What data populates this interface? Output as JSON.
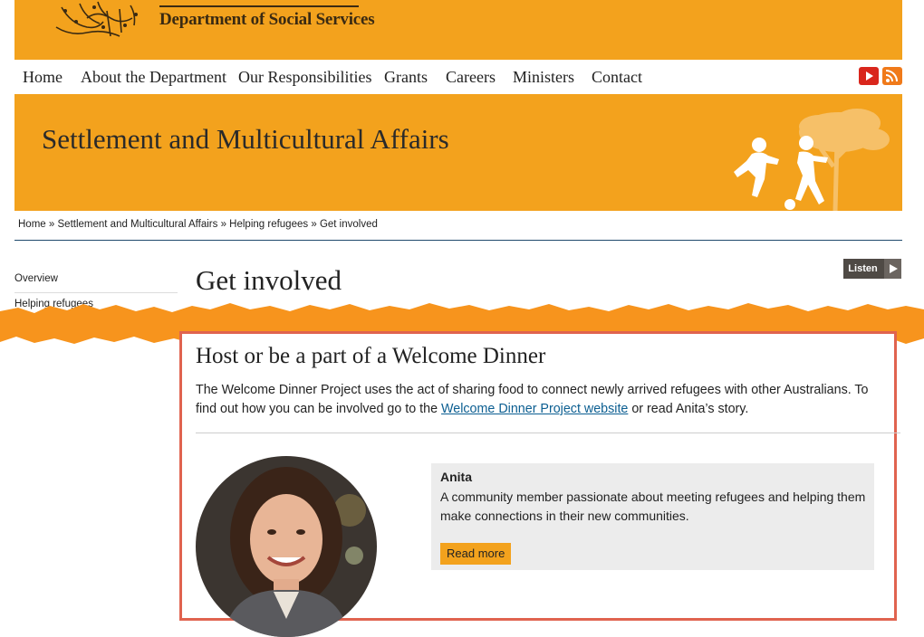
{
  "header": {
    "department": "Department of Social Services"
  },
  "nav": {
    "items": [
      "Home",
      "About the Department",
      "Our Responsibilities",
      "Grants",
      "Careers",
      "Ministers",
      "Contact"
    ],
    "social_icons": [
      "youtube-icon",
      "rss-icon"
    ]
  },
  "banner": {
    "title": "Settlement and Multicultural Affairs"
  },
  "breadcrumb": {
    "items": [
      "Home",
      "Settlement and Multicultural Affairs",
      "Helping refugees",
      "Get involved"
    ],
    "separator": "»"
  },
  "sidebar": {
    "items": [
      "Overview",
      "Helping refugees"
    ]
  },
  "page": {
    "title": "Get involved",
    "listen_label": "Listen"
  },
  "section": {
    "title": "Host or be a part of a Welcome Dinner",
    "intro_before": "The Welcome Dinner Project uses the act of sharing food to connect newly arrived refugees with other Australians. To find out how you can be involved go to the ",
    "intro_link": "Welcome Dinner Project website",
    "intro_after": " or read Anita’s story."
  },
  "story": {
    "name": "Anita",
    "description": "A community member passionate about meeting refugees and helping them make connections in their new communities.",
    "button": "Read more"
  },
  "colors": {
    "brand": "#f3a21d",
    "highlight": "#e0634f",
    "link": "#0b5e91",
    "torn": "#f7941d"
  }
}
